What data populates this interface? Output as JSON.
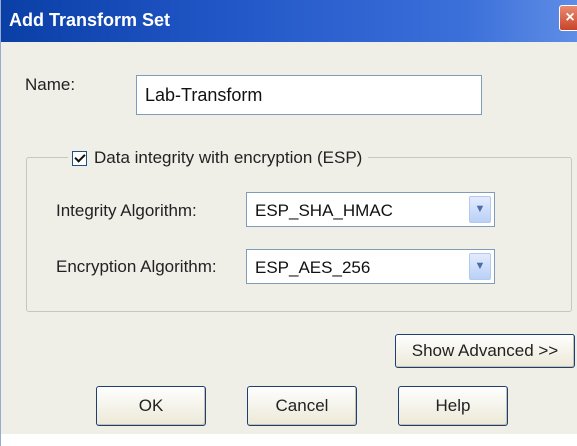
{
  "window": {
    "title": "Add Transform Set",
    "close_glyph": "×"
  },
  "name_field": {
    "label": "Name:",
    "value": "Lab-Transform"
  },
  "esp_group": {
    "checkbox_label": "Data integrity with encryption (ESP)",
    "checked": true,
    "integrity": {
      "label": "Integrity Algorithm:",
      "value": "ESP_SHA_HMAC"
    },
    "encryption": {
      "label": "Encryption Algorithm:",
      "value": "ESP_AES_256"
    }
  },
  "buttons": {
    "show_advanced": "Show Advanced >>",
    "ok": "OK",
    "cancel": "Cancel",
    "help": "Help"
  },
  "icons": {
    "close": "close-icon",
    "dropdown": "chevron-down-icon"
  },
  "colors": {
    "titlebar": "#0a3fa6",
    "dialog_bg": "#f0efe7",
    "close_button": "#c8452a"
  }
}
